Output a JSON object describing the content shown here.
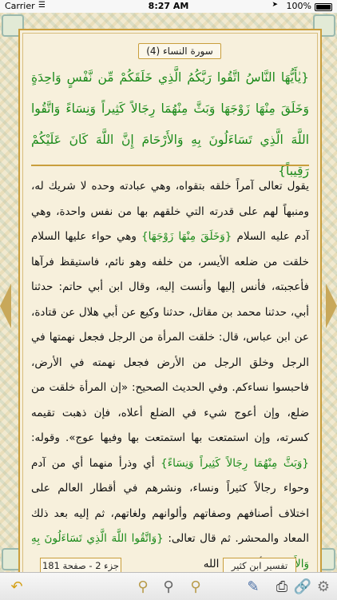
{
  "status_bar": {
    "carrier": "Carrier",
    "time": "8:27 AM",
    "battery": "100%"
  },
  "page": {
    "surah_title": "(4) سورة النساء",
    "verse": "{يٰأَيُّهَا النَّاسُ اتَّقُوا رَبَّكُمُ الَّذِي خَلَقَكُمْ مِّن نَّفْسٍ وَاحِدَةٍ وَخَلَقَ مِنْهَا زَوْجَهَا وَبَثَّ مِنْهُمَا رِجَالاً كَثِيراً وَنِسَاءً وَاتَّقُوا اللَّهَ الَّذِي تَسَاءَلُونَ بِهِ وَالأَرْحَامَ إِنَّ اللَّهَ كَانَ عَلَيْكُمْ رَقِيباً}",
    "tafsir": {
      "p1": "يقول تعالى آمراً خلقه بتقواه، وهي عبادته وحده لا شريك له، ومنبهاً لهم على قدرته التي خلقهم بها من نفس واحدة، وهي آدم عليه السلام ",
      "q1": "{وَخَلَقَ مِنْهَا زَوْجَهَا}",
      "p2": " وهي حواء عليها السلام خلقت من ضلعه الأيسر، من خلفه وهو نائم، فاستيقظ فرآها فأعجبته، فأنس إليها وأنست إليه، وقال ابن أبي حاتم: حدثنا أبي، حدثنا محمد بن مقاتل، حدثنا وكيع عن أبي هلال عن قتادة، عن ابن عباس، قال: خلقت المرأة من الرجل فجعل نهمتها في الرجل وخلق الرجل من الأرض فجعل نهمته في الأرض، فاحبسوا نساءكم. وفي الحديث الصحيح: «إن المرأة خلقت من ضلع، وإن أعوج شيء في الضلع أعلاه، فإن ذهبت تقيمه كسرته، وإن استمتعت بها استمتعت بها وفيها عوج». وقوله: ",
      "q2": "{وَبَثَّ مِنْهُمَا رِجَالاً كَثِيراً وَنِسَاءً}",
      "p3": " أي وذرأ منهما أي من آدم وحواء رجالاً كثيراً ونساء، ونشرهم في أقطار العالم على اختلاف أصنافهم وصفاتهم وألوانهم ولغاتهم، ثم إليه بعد ذلك المعاد والمحشر. ثم قال تعالى: ",
      "q3": "{وَاتَّقُوا اللَّهَ الَّذِي تَسَاءَلُونَ بِهِ وَالأَرْحَامَ}",
      "p4": " أي واتقوا الله"
    },
    "page_info": "جزء 2 - صفحة 181",
    "book_info": "تفسير ابن كثير"
  },
  "toolbar": {
    "buttons": [
      "back-icon",
      "zoom-out-icon",
      "search-icon",
      "zoom-in-icon",
      "pen-icon",
      "print-icon",
      "link-icon",
      "settings-icon"
    ]
  },
  "colors": {
    "verse_green": "#1a8a1a",
    "frame_gold": "#c99e3c",
    "paper": "#f7f0dc"
  }
}
